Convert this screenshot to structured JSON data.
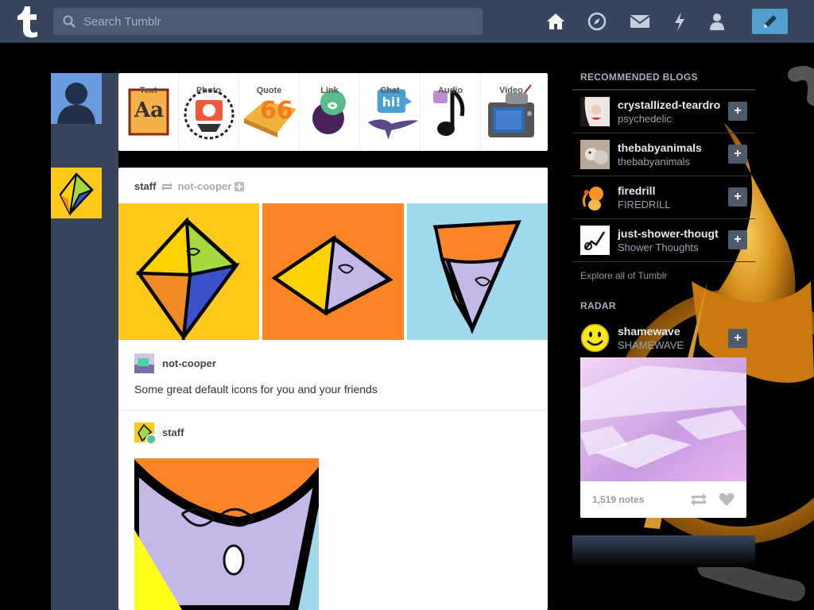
{
  "topbar": {
    "search_placeholder": "Search Tumblr",
    "nav_icons": [
      "home-icon",
      "explore-icon",
      "inbox-icon",
      "activity-icon",
      "account-icon"
    ],
    "compose_icon": "pencil-icon"
  },
  "post_types": [
    {
      "label": "Text",
      "icon": "text-icon"
    },
    {
      "label": "Photo",
      "icon": "photo-icon"
    },
    {
      "label": "Quote",
      "icon": "quote-icon"
    },
    {
      "label": "Link",
      "icon": "link-icon"
    },
    {
      "label": "Chat",
      "icon": "chat-icon"
    },
    {
      "label": "Audio",
      "icon": "audio-icon"
    },
    {
      "label": "Video",
      "icon": "video-icon"
    }
  ],
  "post": {
    "author": "staff",
    "reblogged_from": "not-cooper",
    "source_author": "not-cooper",
    "caption": "Some great default icons for you and your friends",
    "reblogger": "staff"
  },
  "sidebar": {
    "recommended_title": "RECOMMENDED BLOGS",
    "recommended": [
      {
        "name": "crystallized-teardro",
        "title": "psychedelic"
      },
      {
        "name": "thebabyanimals",
        "title": "thebabyanimals"
      },
      {
        "name": "firedrill",
        "title": "FIREDRILL"
      },
      {
        "name": "just-shower-thougt",
        "title": "Shower Thoughts"
      }
    ],
    "follow_label": "+",
    "explore_link": "Explore all of Tumblr",
    "radar_title": "RADAR",
    "radar": {
      "name": "shamewave",
      "title": "SHAMEWAVE",
      "notes": "1,519 notes"
    }
  },
  "colors": {
    "topbar": "#36465d",
    "accent": "#529ecc",
    "background": "#000000"
  }
}
